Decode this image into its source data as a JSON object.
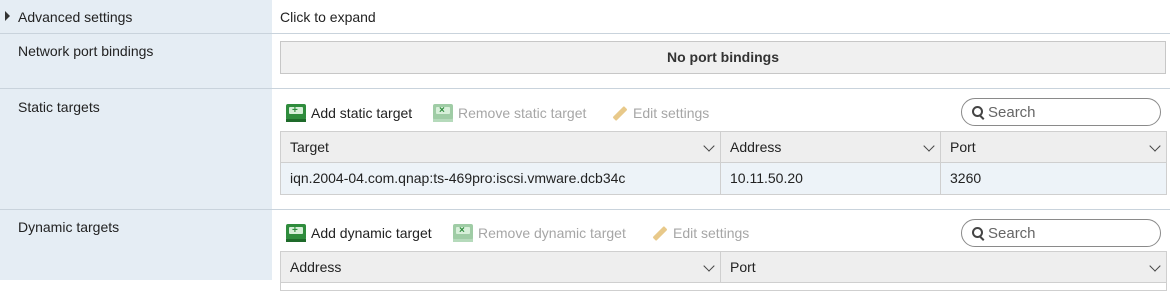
{
  "advanced": {
    "label": "Advanced settings",
    "value": "Click to expand"
  },
  "network_port_bindings": {
    "label": "Network port bindings",
    "empty_text": "No port bindings"
  },
  "static_targets": {
    "label": "Static targets",
    "toolbar": {
      "add": "Add static target",
      "remove": "Remove static target",
      "edit": "Edit settings"
    },
    "search": {
      "placeholder": "Search",
      "value": ""
    },
    "columns": [
      "Target",
      "Address",
      "Port"
    ],
    "rows": [
      {
        "target": "iqn.2004-04.com.qnap:ts-469pro:iscsi.vmware.dcb34c",
        "address": "10.11.50.20",
        "port": "3260"
      }
    ]
  },
  "dynamic_targets": {
    "label": "Dynamic targets",
    "toolbar": {
      "add": "Add dynamic target",
      "remove": "Remove dynamic target",
      "edit": "Edit settings"
    },
    "search": {
      "placeholder": "Search",
      "value": ""
    },
    "columns": [
      "Address",
      "Port"
    ]
  },
  "colors": {
    "label_bg": "#e5edf4",
    "row_selected_bg": "#edf3f8",
    "disabled_text": "#a6a6a6"
  }
}
